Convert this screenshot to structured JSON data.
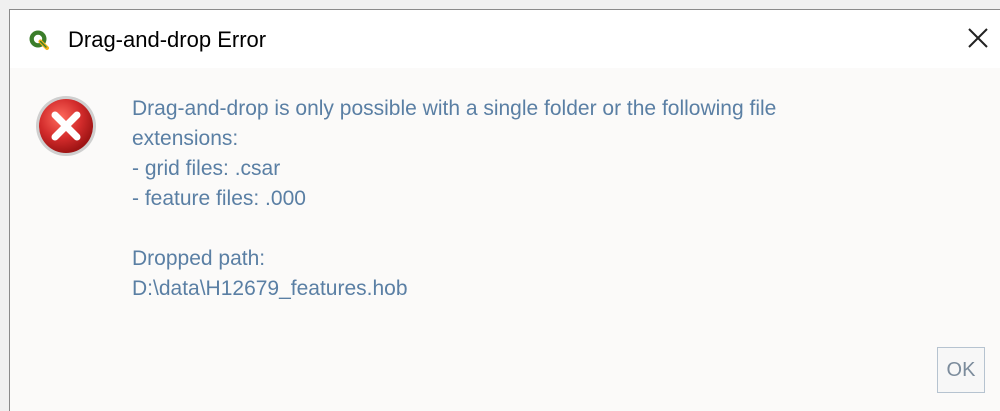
{
  "window": {
    "title": "Drag-and-drop Error",
    "app_icon": "qgis-icon",
    "close_icon": "close-icon"
  },
  "message": {
    "icon": "error-icon",
    "lines": [
      "Drag-and-drop is only possible with a single folder or the following file",
      "extensions:",
      "- grid files: .csar",
      "- feature files: .000"
    ],
    "dropped_label": "Dropped path:",
    "dropped_path": "D:\\data\\H12679_features.hob"
  },
  "buttons": {
    "ok_label": "OK"
  },
  "colors": {
    "message_text": "#5a7fa4",
    "error_red": "#d22b2b",
    "dialog_background": "#fbfaf9"
  }
}
